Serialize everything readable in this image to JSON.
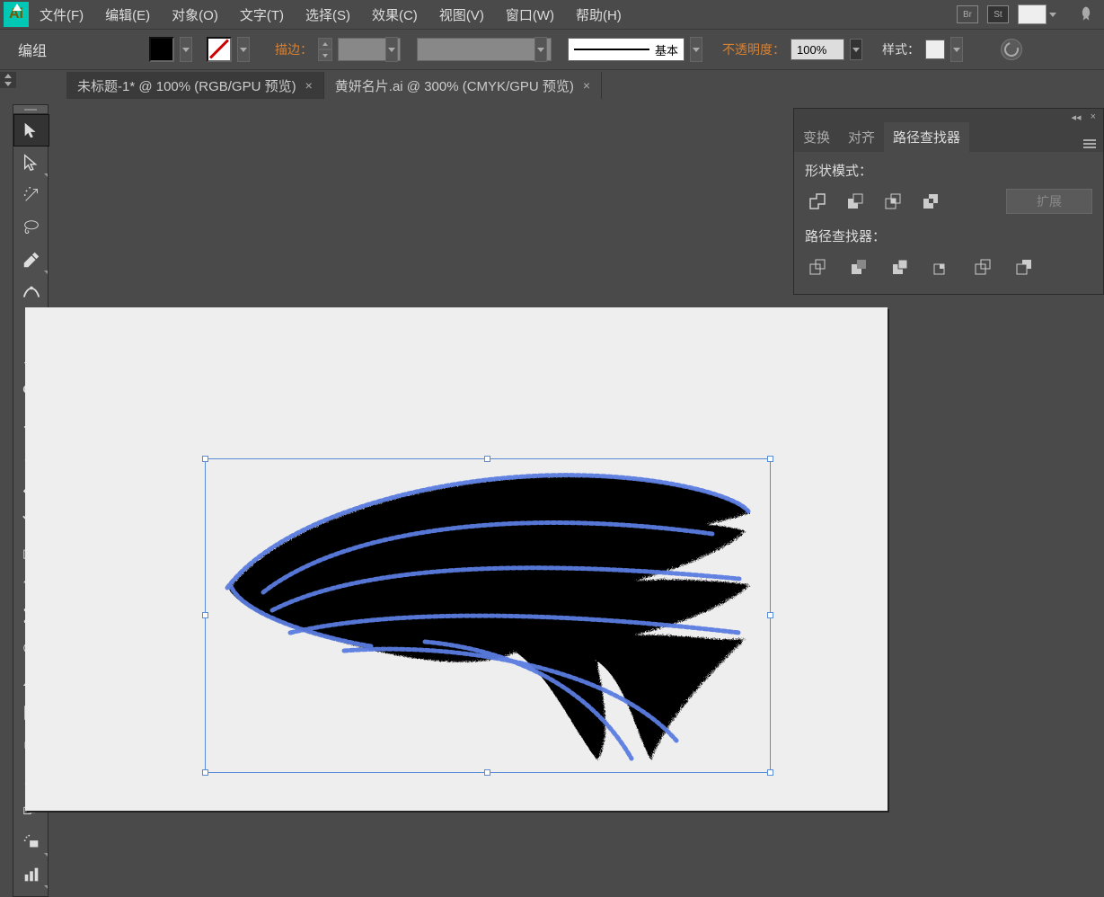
{
  "menu": {
    "items": [
      "文件(F)",
      "编辑(E)",
      "对象(O)",
      "文字(T)",
      "选择(S)",
      "效果(C)",
      "视图(V)",
      "窗口(W)",
      "帮助(H)"
    ],
    "br": "Br",
    "st": "St"
  },
  "control": {
    "mode": "编组",
    "stroke_label": "描边：",
    "brush_name": "基本",
    "opacity_label": "不透明度：",
    "opacity_value": "100%",
    "style_label": "样式："
  },
  "tabs": [
    {
      "title": "未标题-1* @ 100% (RGB/GPU 预览)",
      "active": true
    },
    {
      "title": "黄妍名片.ai @ 300% (CMYK/GPU 预览)",
      "active": false
    }
  ],
  "panel": {
    "tabs": [
      "变换",
      "对齐",
      "路径查找器"
    ],
    "active_tab": 2,
    "shape_modes_label": "形状模式：",
    "expand_label": "扩展",
    "pathfinders_label": "路径查找器："
  },
  "tools": [
    "selection",
    "direct-selection",
    "magic-wand",
    "lasso",
    "pen",
    "curvature",
    "type",
    "line",
    "ellipse",
    "paintbrush",
    "pencil",
    "eraser",
    "rotate",
    "scale",
    "width",
    "free-transform",
    "shape-builder",
    "perspective",
    "mesh",
    "gradient",
    "eyedropper",
    "blend",
    "symbol-sprayer",
    "column-graph"
  ]
}
